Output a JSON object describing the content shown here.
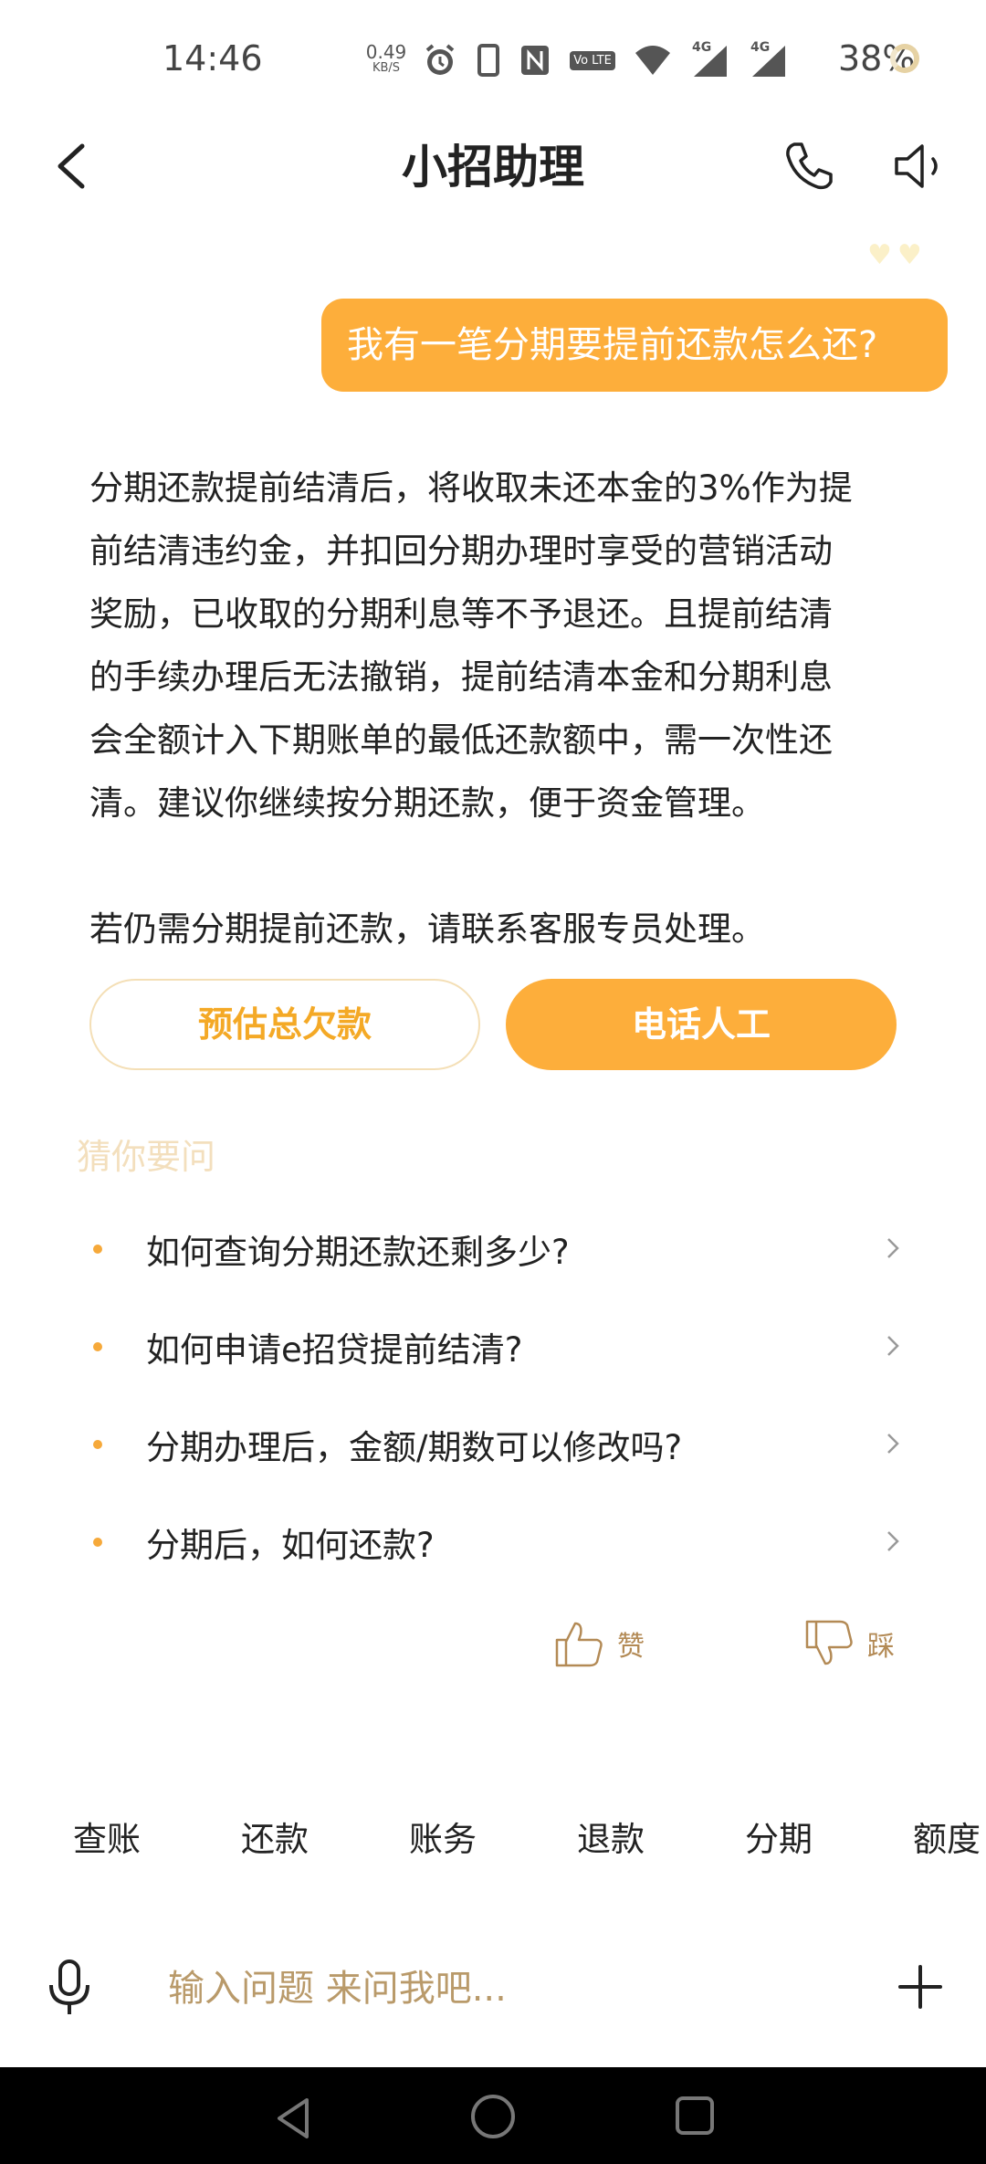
{
  "status_bar": {
    "time": "14:46",
    "net_speed_value": "0.49",
    "net_speed_unit": "KB/S",
    "volte_label": "Vo LTE",
    "signal1_label": "4G",
    "signal2_label": "4G",
    "battery": "38%"
  },
  "header": {
    "title": "小招助理"
  },
  "chat": {
    "user_message": "我有一笔分期要提前还款怎么还?",
    "bot_reply": "分期还款提前结清后，将收取未还本金的3%作为提\n前结清违约金，并扣回分期办理时享受的营销活动\n奖励，已收取的分期利息等不予退还。且提前结清\n的手续办理后无法撤销，提前结清本金和分期利息\n会全额计入下期账单的最低还款额中，需一次性还\n清。建议你继续按分期还款，便于资金管理。\n\n若仍需分期提前还款，请联系客服专员处理。",
    "btn_estimate": "预估总欠款",
    "btn_call": "电话人工"
  },
  "suggestions": {
    "title": "猜你要问",
    "items": [
      "如何查询分期还款还剩多少?",
      "如何申请e招贷提前结清?",
      "分期办理后，金额/期数可以修改吗?",
      "分期后，如何还款?"
    ]
  },
  "feedback": {
    "like_label": "赞",
    "dislike_label": "踩"
  },
  "quick_tabs": [
    "查账",
    "还款",
    "账务",
    "退款",
    "分期",
    "额度"
  ],
  "input": {
    "placeholder": "输入问题 来问我吧..."
  },
  "colors": {
    "accent": "#fdae3b",
    "accent_text": "#f4a926",
    "muted": "#f3dfbd"
  }
}
